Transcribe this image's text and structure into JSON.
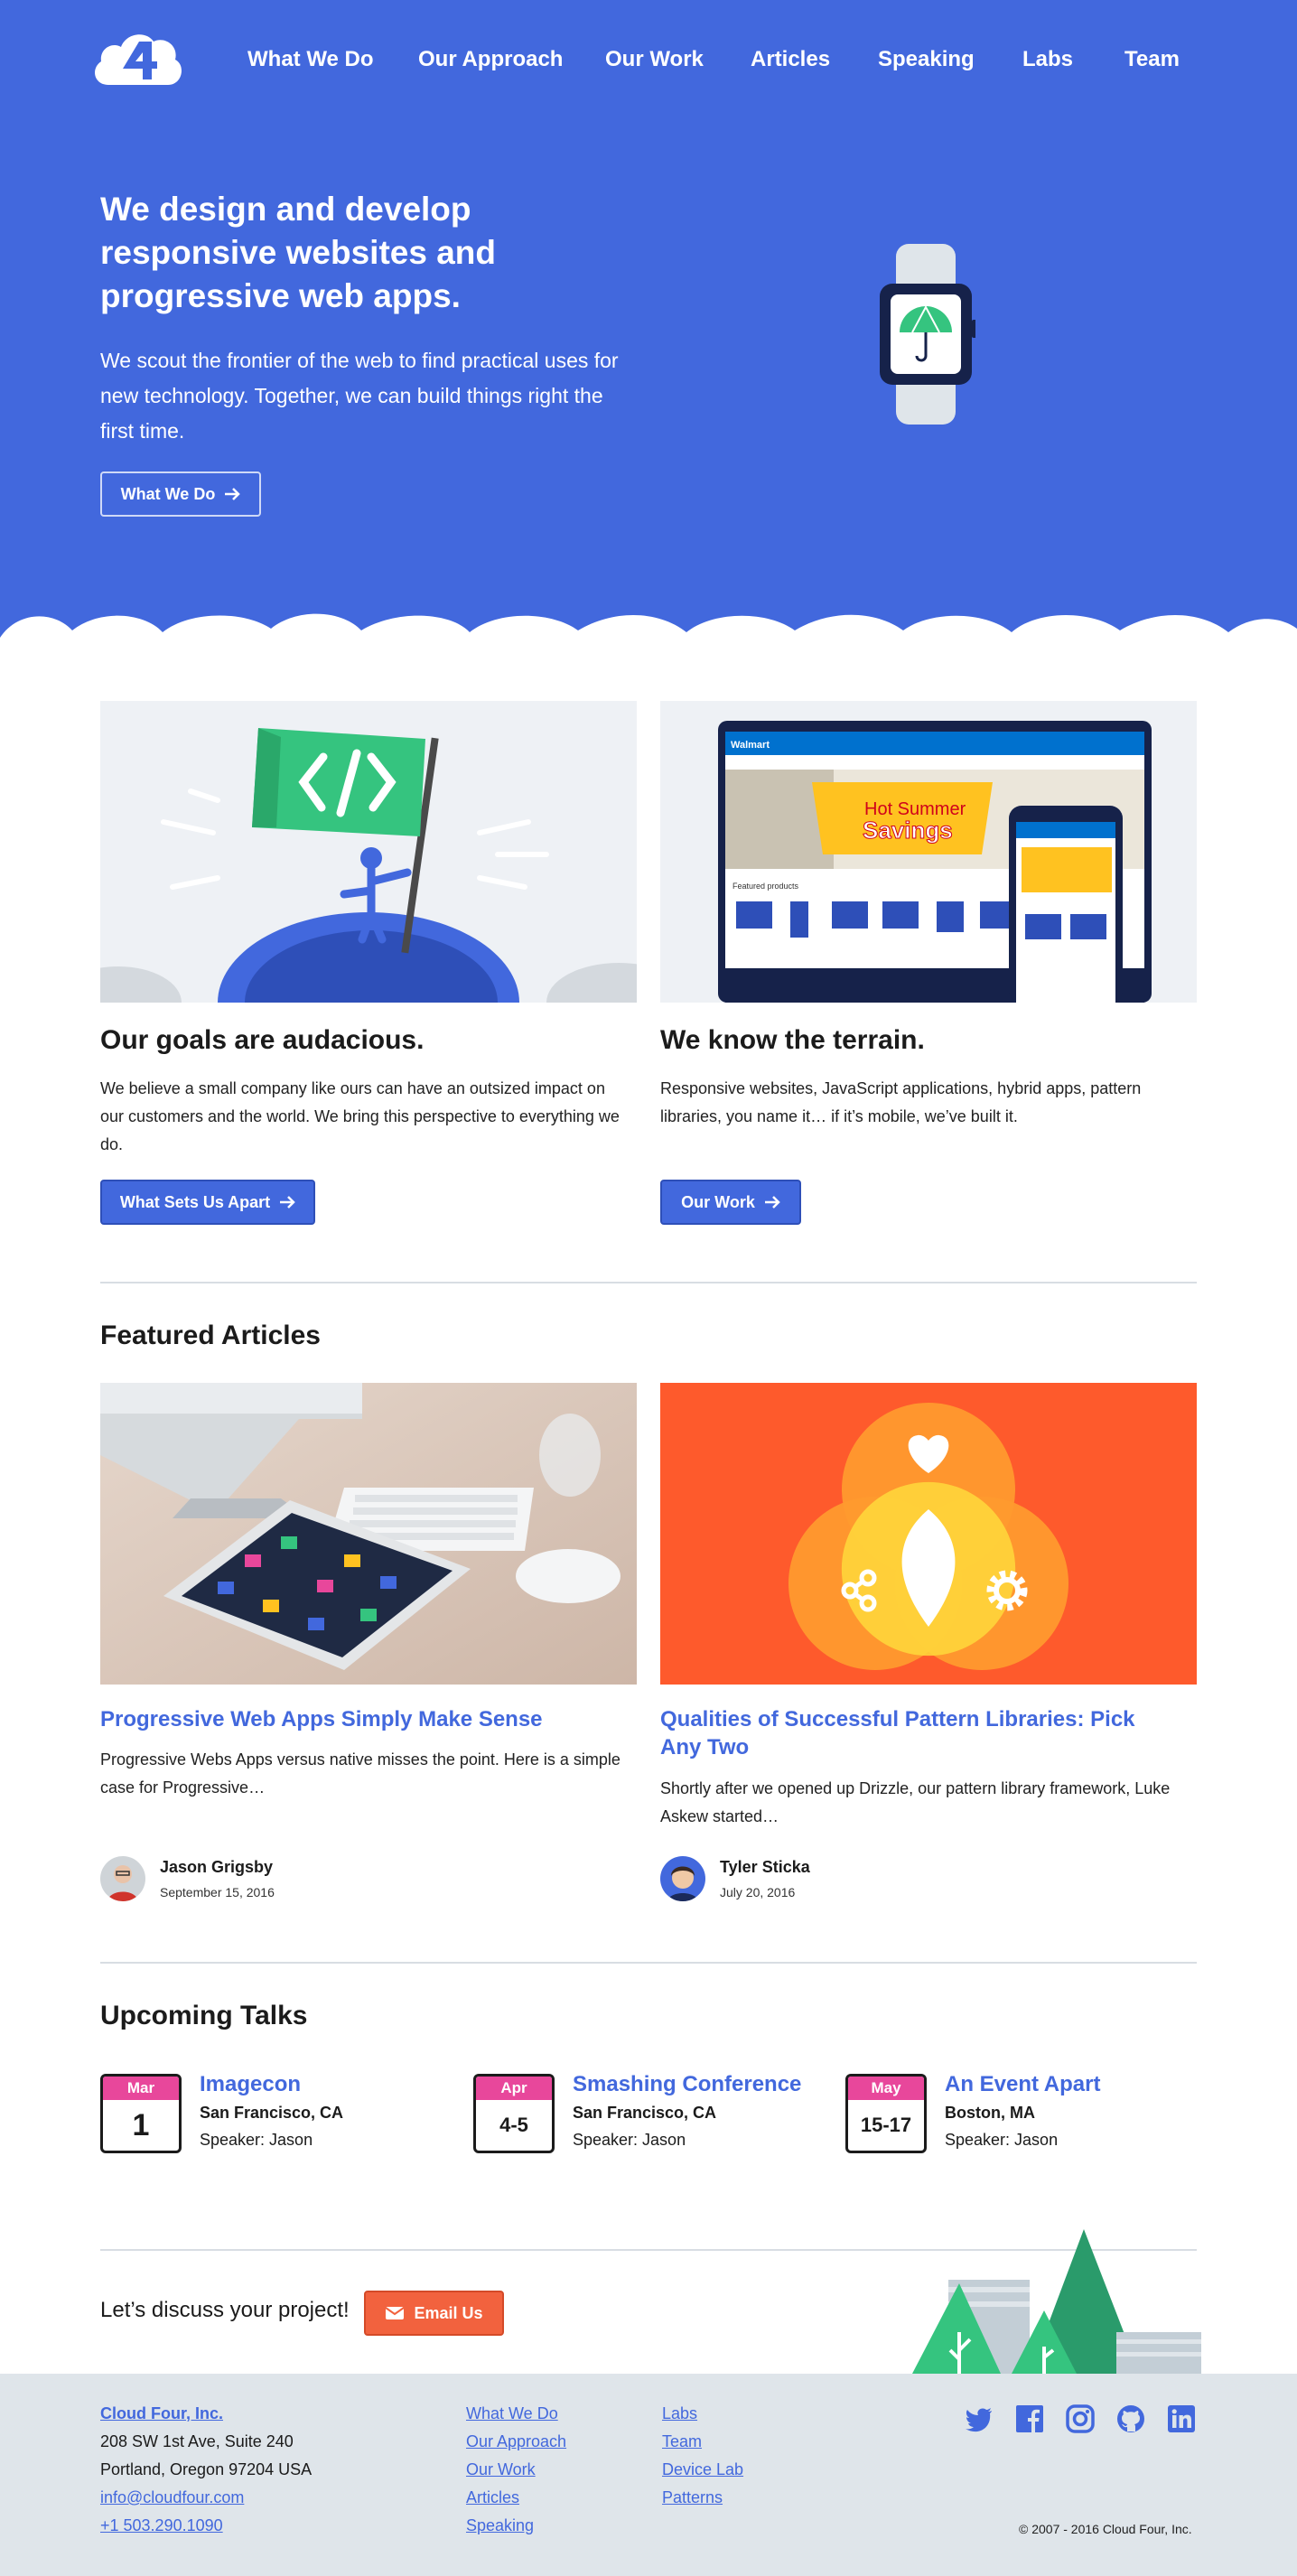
{
  "brand": {
    "primary": "#4268dd",
    "accent": "#e8479b",
    "cta": "#f2623e",
    "footer_bg": "#dfe5ea"
  },
  "nav": {
    "items": [
      "What We Do",
      "Our Approach",
      "Our Work",
      "Articles",
      "Speaking",
      "Labs",
      "Team"
    ]
  },
  "hero": {
    "title": "We design and develop responsive websites and progressive web apps.",
    "body": "We scout the frontier of the web to find practical uses for new technology. Together, we can build things right the first time.",
    "button_label": "What We Do",
    "illustration_icon": "smartwatch-umbrella-icon"
  },
  "features": [
    {
      "title": "Our goals are audacious.",
      "body": "We believe a small company like ours can have an outsized impact on our customers and the world. We bring this perspective to everything we do.",
      "button_label": "What Sets Us Apart",
      "image_icon": "code-flag-icon"
    },
    {
      "title": "We know the terrain.",
      "body": "Responsive websites, JavaScript applications, hybrid apps, pattern libraries, you name it… if it’s mobile, we’ve built it.",
      "button_label": "Our Work",
      "image_icon": "responsive-devices-icon",
      "screenshot_text": {
        "brand": "Walmart",
        "promo_line1": "Hot Summer",
        "promo_line2": "Savings",
        "sub": "Featured products"
      }
    }
  ],
  "articles_section": {
    "title": "Featured Articles",
    "items": [
      {
        "title": "Progressive Web Apps Simply Make Sense",
        "excerpt": "Progressive Webs Apps versus native misses the point. Here is a simple case for Progressive…",
        "author": "Jason Grigsby",
        "date": "September 15, 2016"
      },
      {
        "title": "Qualities of Successful Pattern Libraries: Pick Any Two",
        "excerpt": "Shortly after we opened up Drizzle, our pattern library framework, Luke Askew started…",
        "author": "Tyler Sticka",
        "date": "July 20, 2016"
      }
    ]
  },
  "talks_section": {
    "title": "Upcoming Talks",
    "items": [
      {
        "month": "Mar",
        "day": "1",
        "name": "Imagecon",
        "location": "San Francisco, CA",
        "speaker": "Speaker: Jason"
      },
      {
        "month": "Apr",
        "day": "4-5",
        "name": "Smashing Conference",
        "location": "San Francisco, CA",
        "speaker": "Speaker: Jason"
      },
      {
        "month": "May",
        "day": "15-17",
        "name": "An Event Apart",
        "location": "Boston, MA",
        "speaker": "Speaker: Jason"
      }
    ]
  },
  "cta": {
    "text": "Let’s discuss your project!",
    "button_label": "Email Us"
  },
  "footer": {
    "company": "Cloud Four, Inc.",
    "address1": "208 SW 1st Ave, Suite 240",
    "address2": "Portland, Oregon 97204 USA",
    "email": "info@cloudfour.com",
    "phone": "+1 503.290.1090",
    "col1": [
      "What We Do",
      "Our Approach",
      "Our Work",
      "Articles",
      "Speaking"
    ],
    "col2": [
      "Labs",
      "Team",
      "Device Lab",
      "Patterns"
    ],
    "social": [
      "twitter-icon",
      "facebook-icon",
      "instagram-icon",
      "github-icon",
      "linkedin-icon"
    ],
    "copyright": "© 2007 - 2016 Cloud Four, Inc."
  }
}
